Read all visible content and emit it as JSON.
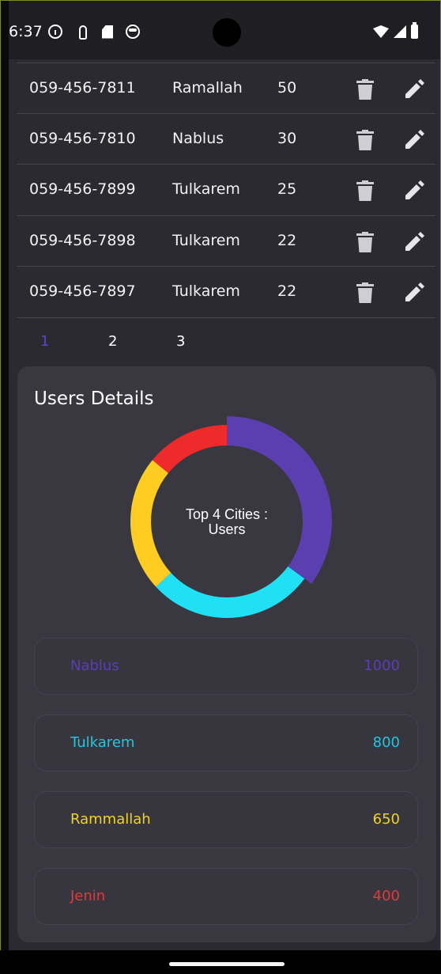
{
  "status_bar": {
    "time": "6:37",
    "icons": [
      "info-icon",
      "navigation-icon",
      "sd-card-icon",
      "disc-icon"
    ],
    "right_icons": [
      "wifi-icon",
      "signal-icon",
      "battery-icon"
    ]
  },
  "table": {
    "rows": [
      {
        "phone": "059-456-7811",
        "city": "Ramallah",
        "count": "50"
      },
      {
        "phone": "059-456-7810",
        "city": "Nablus",
        "count": "30"
      },
      {
        "phone": "059-456-7899",
        "city": "Tulkarem",
        "count": "25"
      },
      {
        "phone": "059-456-7898",
        "city": "Tulkarem",
        "count": "22"
      },
      {
        "phone": "059-456-7897",
        "city": "Tulkarem",
        "count": "22"
      }
    ],
    "row_actions": [
      "delete-icon",
      "edit-icon"
    ]
  },
  "pagination": {
    "pages": [
      "1",
      "2",
      "3"
    ],
    "active": "1"
  },
  "users_card": {
    "title": "Users Details",
    "chart_center_line1": "Top 4 Cities :",
    "chart_center_line2": "Users"
  },
  "chart_data": {
    "type": "pie",
    "title": "Top 4 Cities : Users",
    "categories": [
      "Nablus",
      "Tulkarem",
      "Rammallah",
      "Jenin"
    ],
    "values": [
      1000,
      800,
      650,
      400
    ],
    "colors": [
      "#5b3fb0",
      "#1fe0f5",
      "#ffcc22",
      "#ee2a2a"
    ]
  },
  "legend": [
    {
      "name": "Nablus",
      "value": "1000",
      "color": "#5a3db8"
    },
    {
      "name": "Tulkarem",
      "value": "800",
      "color": "#25c5dd"
    },
    {
      "name": "Rammallah",
      "value": "650",
      "color": "#f1d324"
    },
    {
      "name": "Jenin",
      "value": "400",
      "color": "#e03a3a"
    }
  ]
}
